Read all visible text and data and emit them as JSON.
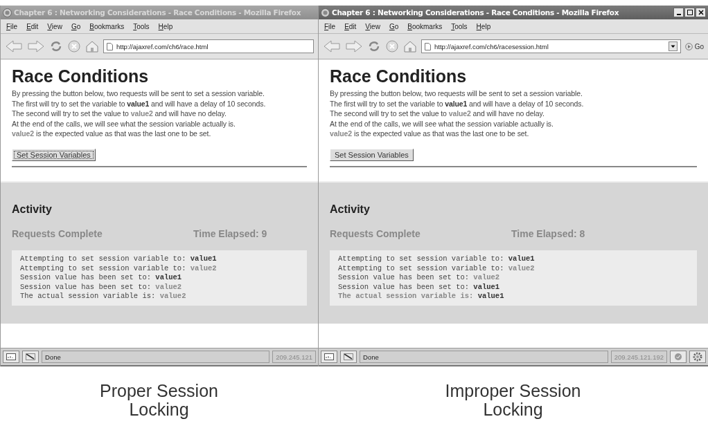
{
  "windows": [
    {
      "title": "Chapter 6 : Networking Considerations - Race Conditions - Mozilla Firefox",
      "active": false,
      "window_controls": false,
      "menu": [
        "File",
        "Edit",
        "View",
        "Go",
        "Bookmarks",
        "Tools",
        "Help"
      ],
      "url": "http://ajaxref.com/ch6/race.html",
      "url_dropdown": false,
      "heading": "Race Conditions",
      "intro": [
        [
          {
            "kind": "plain",
            "text": "By pressing the button below, two requests will be sent to set a session variable."
          }
        ],
        [
          {
            "kind": "plain",
            "text": "The first will try to set the variable to "
          },
          {
            "kind": "bold",
            "text": "value1"
          },
          {
            "kind": "plain",
            "text": " and will have a delay of 10 seconds."
          }
        ],
        [
          {
            "kind": "plain",
            "text": "The second will try to set the value to "
          },
          {
            "kind": "muted",
            "text": "value2"
          },
          {
            "kind": "plain",
            "text": " and will have no delay."
          }
        ],
        [
          {
            "kind": "plain",
            "text": "At the end of the calls, we will see what the session variable actually is."
          }
        ],
        [
          {
            "kind": "muted",
            "text": "value2"
          },
          {
            "kind": "plain",
            "text": " is the expected value as that was the last one to be set."
          }
        ]
      ],
      "button": "Set Session Variables",
      "button_focused": true,
      "activity_title": "Activity",
      "requests": "Requests Complete",
      "elapsed": "Time Elapsed: 9",
      "log": [
        [
          {
            "kind": "plain",
            "text": "Attempting to set session variable to: "
          },
          {
            "kind": "bold",
            "text": "value1"
          }
        ],
        [
          {
            "kind": "plain",
            "text": "Attempting to set session variable to: "
          },
          {
            "kind": "muted",
            "text": "value2"
          }
        ],
        [
          {
            "kind": "plain",
            "text": "Session value has been set to: "
          },
          {
            "kind": "bold",
            "text": "value1"
          }
        ],
        [
          {
            "kind": "plain",
            "text": "Session value has been set to: "
          },
          {
            "kind": "muted",
            "text": "value2"
          }
        ],
        [
          {
            "kind": "plain",
            "text": "The actual session variable is: "
          },
          {
            "kind": "muted",
            "text": "value2"
          }
        ]
      ],
      "status": "Done",
      "ip": "209.245.121",
      "status_icons": false,
      "caption": "Proper Session Locking"
    },
    {
      "title": "Chapter 6 : Networking Considerations - Race Conditions - Mozilla Firefox",
      "active": true,
      "window_controls": true,
      "menu": [
        "File",
        "Edit",
        "View",
        "Go",
        "Bookmarks",
        "Tools",
        "Help"
      ],
      "url": "http://ajaxref.com/ch6/racesession.html",
      "url_dropdown": true,
      "go": "Go",
      "heading": "Race Conditions",
      "intro": [
        [
          {
            "kind": "plain",
            "text": "By pressing the button below, two requests will be sent to set a session variable."
          }
        ],
        [
          {
            "kind": "plain",
            "text": "The first will try to set the variable to "
          },
          {
            "kind": "bold",
            "text": "value1"
          },
          {
            "kind": "plain",
            "text": " and will have a delay of 10 seconds."
          }
        ],
        [
          {
            "kind": "plain",
            "text": "The second will try to set the value to "
          },
          {
            "kind": "muted",
            "text": "value2"
          },
          {
            "kind": "plain",
            "text": " and will have no delay."
          }
        ],
        [
          {
            "kind": "plain",
            "text": "At the end of the calls, we will see what the session variable actually is."
          }
        ],
        [
          {
            "kind": "muted",
            "text": "value2"
          },
          {
            "kind": "plain",
            "text": " is the expected value as that was the last one to be set."
          }
        ]
      ],
      "button": "Set Session Variables",
      "button_focused": false,
      "activity_title": "Activity",
      "requests": "Requests Complete",
      "elapsed": "Time Elapsed: 8",
      "log": [
        [
          {
            "kind": "plain",
            "text": "Attempting to set session variable to: "
          },
          {
            "kind": "bold",
            "text": "value1"
          }
        ],
        [
          {
            "kind": "plain",
            "text": "Attempting to set session variable to: "
          },
          {
            "kind": "muted",
            "text": "value2"
          }
        ],
        [
          {
            "kind": "plain",
            "text": "Session value has been set to: "
          },
          {
            "kind": "muted",
            "text": "value2"
          }
        ],
        [
          {
            "kind": "plain",
            "text": "Session value has been set to: "
          },
          {
            "kind": "bold",
            "text": "value1"
          }
        ],
        [
          {
            "kind": "muted",
            "text": "The actual session variable is: "
          },
          {
            "kind": "bold",
            "text": "value1"
          }
        ]
      ],
      "status": "Done",
      "ip": "209.245.121.192",
      "status_icons": true,
      "caption": "Improper Session Locking"
    }
  ]
}
